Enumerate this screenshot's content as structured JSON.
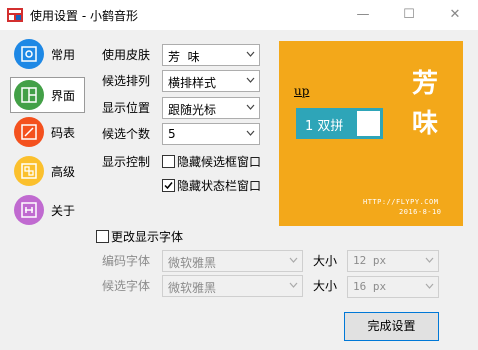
{
  "window": {
    "title": "使用设置 - 小鹤音形",
    "minimize": "—",
    "maximize": "☐",
    "close": "✕"
  },
  "sidebar": {
    "items": [
      {
        "label": "常用",
        "icon": "settings-square-icon",
        "color": "#1e88e5"
      },
      {
        "label": "界面",
        "icon": "layout-grid-icon",
        "color": "#43a047",
        "active": true
      },
      {
        "label": "码表",
        "icon": "pencil-square-icon",
        "color": "#f4511e"
      },
      {
        "label": "高级",
        "icon": "blocks-icon",
        "color": "#fbc02d"
      },
      {
        "label": "关于",
        "icon": "info-frame-icon",
        "color": "#c06ad0"
      }
    ]
  },
  "form": {
    "skin_label": "使用皮肤",
    "skin_value": "芳  味",
    "candidate_layout_label": "候选排列",
    "candidate_layout_value": "横排样式",
    "display_position_label": "显示位置",
    "display_position_value": "跟随光标",
    "candidate_count_label": "候选个数",
    "candidate_count_value": "5",
    "display_control_label": "显示控制",
    "hide_candidate_window_label": "隐藏候选框窗口",
    "hide_candidate_window_checked": false,
    "hide_status_bar_label": "隐藏状态栏窗口",
    "hide_status_bar_checked": true,
    "change_font_label": "更改显示字体",
    "change_font_checked": false,
    "code_font_label": "编码字体",
    "code_font_value": "微软雅黑",
    "code_size_label": "大小",
    "code_size_value": "12 px",
    "candidate_font_label": "候选字体",
    "candidate_font_value": "微软雅黑",
    "candidate_size_label": "大小",
    "candidate_size_value": "16 px"
  },
  "preview": {
    "input_text": "up",
    "candidate_text": "1 双拼",
    "big_char_1": "芳",
    "big_char_2": "味",
    "url": "HTTP://FLYPY.COM",
    "date": "2016-8-10",
    "background_color": "#f3a81a",
    "candidate_box_color": "#2ea5b8"
  },
  "buttons": {
    "finish": "完成设置"
  }
}
